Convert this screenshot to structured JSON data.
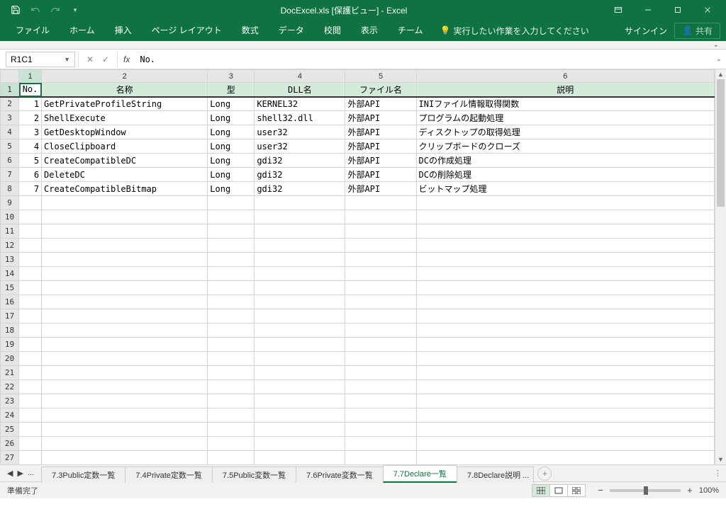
{
  "title": "DocExcel.xls  [保護ビュー] - Excel",
  "ribbon": {
    "tabs": [
      "ファイル",
      "ホーム",
      "挿入",
      "ページ レイアウト",
      "数式",
      "データ",
      "校閲",
      "表示",
      "チーム"
    ],
    "tellme": "実行したい作業を入力してください",
    "signin": "サインイン",
    "share": "共有"
  },
  "name_box": "R1C1",
  "formula": "No.",
  "col_headers": [
    "1",
    "2",
    "3",
    "4",
    "5",
    "6"
  ],
  "header_row": {
    "no": "No.",
    "name": "名称",
    "type": "型",
    "dll": "DLL名",
    "file": "ファイル名",
    "desc": "説明"
  },
  "rows": [
    {
      "no": "1",
      "name": "GetPrivateProfileString",
      "type": "Long",
      "dll": "KERNEL32",
      "file": "外部API",
      "desc": "INIファイル情報取得関数"
    },
    {
      "no": "2",
      "name": "ShellExecute",
      "type": "Long",
      "dll": "shell32.dll",
      "file": "外部API",
      "desc": "プログラムの起動処理"
    },
    {
      "no": "3",
      "name": "GetDesktopWindow",
      "type": "Long",
      "dll": "user32",
      "file": "外部API",
      "desc": "ディスクトップの取得処理"
    },
    {
      "no": "4",
      "name": "CloseClipboard",
      "type": "Long",
      "dll": "user32",
      "file": "外部API",
      "desc": "クリップボードのクローズ"
    },
    {
      "no": "5",
      "name": "CreateCompatibleDC",
      "type": "Long",
      "dll": "gdi32",
      "file": "外部API",
      "desc": "DCの作成処理"
    },
    {
      "no": "6",
      "name": "DeleteDC",
      "type": "Long",
      "dll": "gdi32",
      "file": "外部API",
      "desc": "DCの削除処理"
    },
    {
      "no": "7",
      "name": "CreateCompatibleBitmap",
      "type": "Long",
      "dll": "gdi32",
      "file": "外部API",
      "desc": "ビットマップ処理"
    }
  ],
  "sheet_tabs": [
    "7.3Public定数一覧",
    "7.4Private定数一覧",
    "7.5Public変数一覧",
    "7.6Private変数一覧",
    "7.7Declare一覧",
    "7.8Declare説明 ..."
  ],
  "active_tab": 4,
  "status": "準備完了",
  "zoom": "100%"
}
